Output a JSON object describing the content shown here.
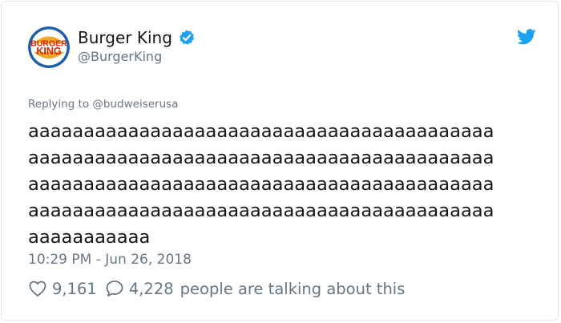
{
  "author": {
    "display_name": "Burger King",
    "handle": "@BurgerKing",
    "verified": true,
    "avatar_logo_text": [
      "BURGER",
      "KING"
    ]
  },
  "icons": {
    "avatar": "burger-king-logo",
    "verified": "verified-badge-icon",
    "platform": "twitter-bird-icon",
    "likes": "heart-icon",
    "replies": "speech-bubble-icon"
  },
  "tweet": {
    "replying_to": "Replying to @budweiserusa",
    "text_lines": [
      "aaaaaaaaaaaaaaaaaaaaaaaaaaaaaaaaaaaaaaaaaa",
      "aaaaaaaaaaaaaaaaaaaaaaaaaaaaaaaaaaaaaaaaaa",
      "aaaaaaaaaaaaaaaaaaaaaaaaaaaaaaaaaaaaaaaaaa",
      "aaaaaaaaaaaaaaaaaaaaaaaaaaaaaaaaaaaaaaaaaa",
      "aaaaaaaaaaa"
    ],
    "timestamp": "10:29 PM - Jun 26, 2018"
  },
  "engagement": {
    "likes": "9,161",
    "replies": "4,228",
    "talking_text": "people are talking about this"
  },
  "colors": {
    "twitter_blue": "#1da1f2",
    "secondary_text": "#657786",
    "primary_text": "#14171a",
    "border": "#e1e8ed",
    "bk_red": "#d62300",
    "bk_orange": "#f5a623",
    "bk_blue": "#1c5ea8"
  }
}
